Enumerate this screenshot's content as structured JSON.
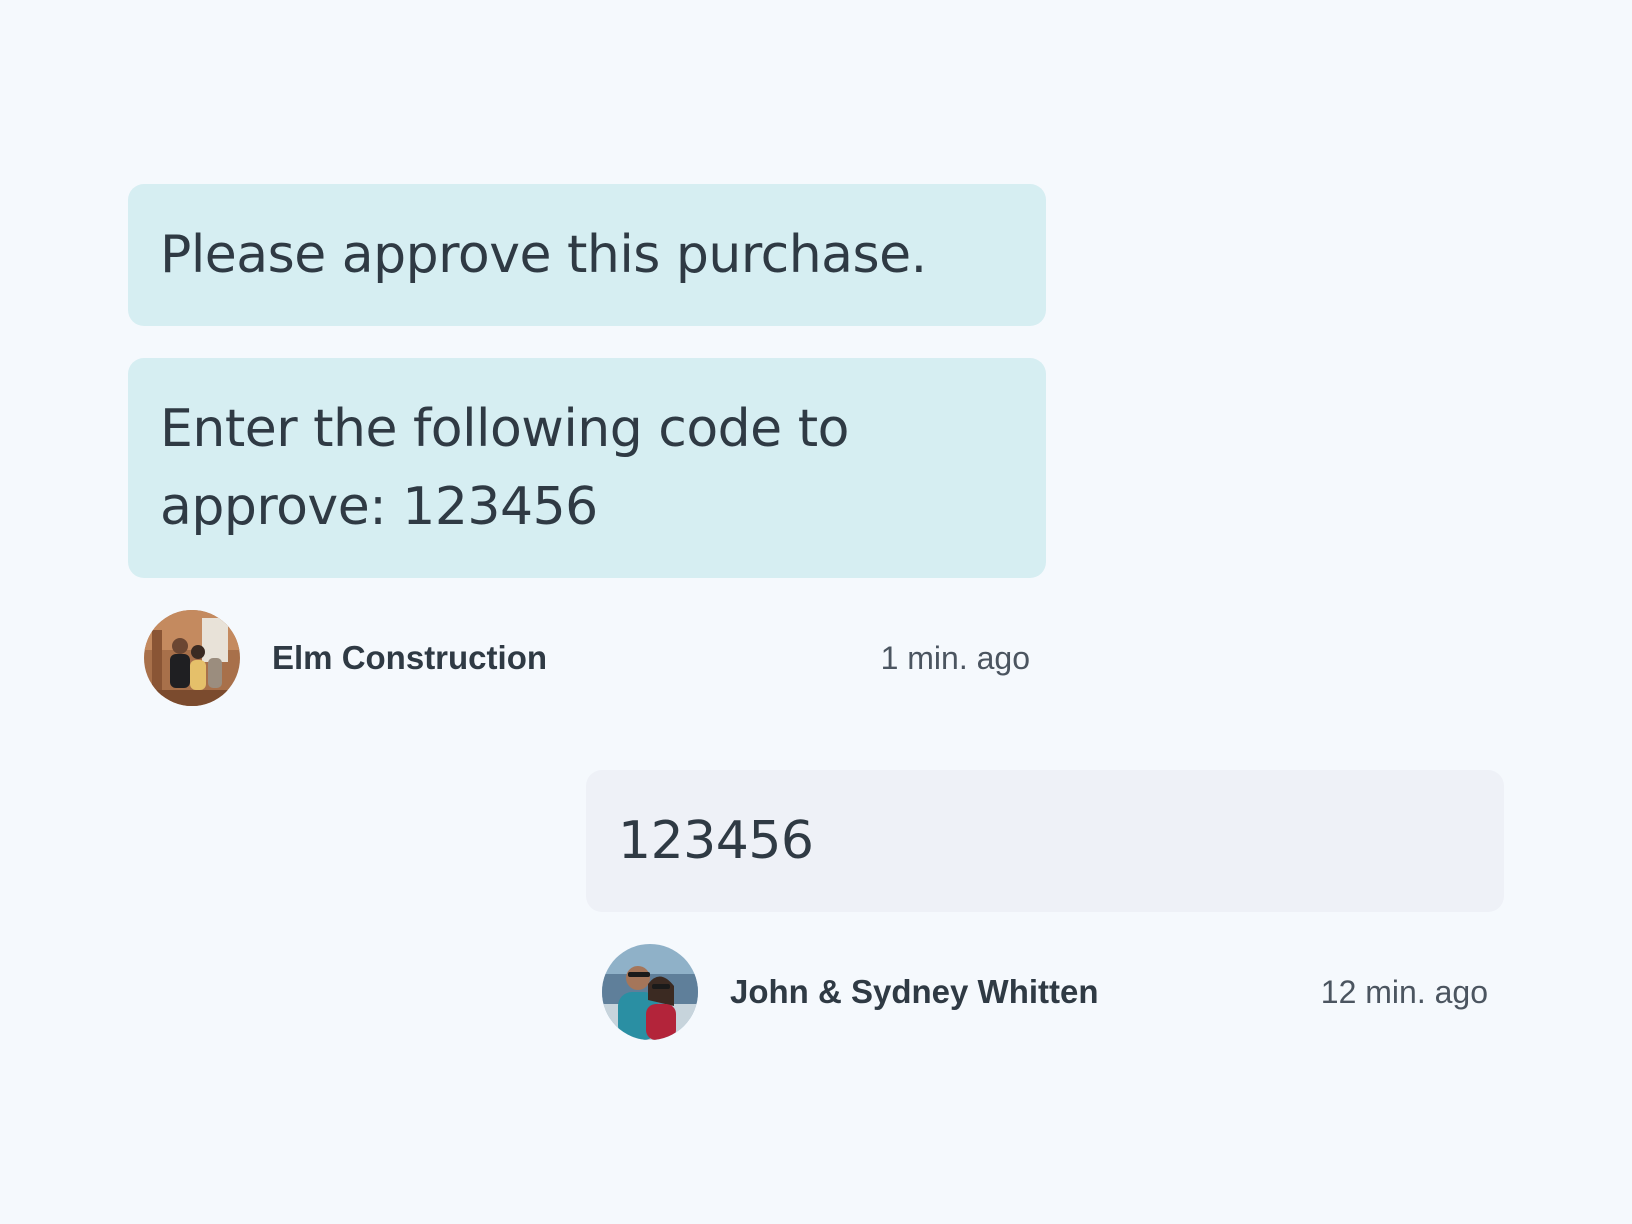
{
  "messages": [
    {
      "direction": "incoming",
      "text": "Please approve this purchase."
    },
    {
      "direction": "incoming",
      "text": "Enter the following code to approve: 123456",
      "sender": "Elm Construction",
      "time": "1 min. ago",
      "avatar_icon": "avatar-photo-icon"
    },
    {
      "direction": "outgoing",
      "text": "123456",
      "sender": "John & Sydney Whitten",
      "time": "12 min. ago",
      "avatar_icon": "avatar-photo-icon"
    }
  ],
  "colors": {
    "background": "#f5f9fd",
    "incoming_bubble": "#d6eef2",
    "outgoing_bubble": "#eef1f7",
    "text": "#2f3a44"
  }
}
